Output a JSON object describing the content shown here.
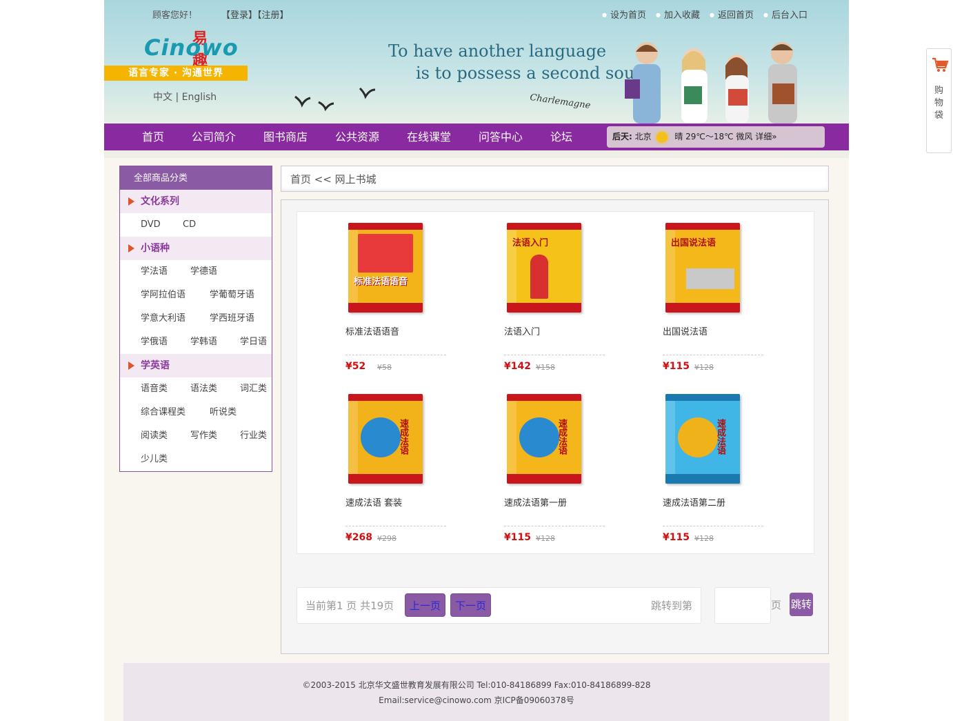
{
  "header": {
    "greeting": "顾客您好！",
    "login": "【登录】",
    "register": "【注册】",
    "top_links": [
      "设为首页",
      "加入收藏",
      "返回首页",
      "后台入口"
    ],
    "logo_cn": "易趣",
    "logo_en": "Cinowo",
    "slogan": "语言专家 · 沟通世界",
    "lang_switch": "中文 | English",
    "quote_line1": "To have another language",
    "quote_line2": "is to possess a second soul.",
    "signature": "Charlemagne"
  },
  "nav": {
    "items": [
      "首页",
      "公司简介",
      "图书商店",
      "公共资源",
      "在线课堂",
      "问答中心",
      "论坛"
    ],
    "weather_day": "后天:",
    "weather_city": "北京",
    "weather_text": "晴  29℃～18℃  微风  详细»"
  },
  "sidebar": {
    "title": "全部商品分类",
    "cat1": "文化系列",
    "cat1_items": [
      "DVD",
      "CD"
    ],
    "cat2": "小语种",
    "cat2_items": [
      "学法语",
      "学德语",
      "学阿拉伯语",
      "学葡萄牙语",
      "学意大利语",
      "学西班牙语",
      "学俄语",
      "学韩语",
      "学日语"
    ],
    "cat3": "学英语",
    "cat3_items": [
      "语音类",
      "语法类",
      "词汇类",
      "综合课程类",
      "听说类",
      "阅读类",
      "写作类",
      "行业类",
      "少儿类"
    ]
  },
  "breadcrumb": "首页 << 网上书城",
  "products": [
    {
      "name": "标准法语语音",
      "price": "¥52",
      "old": "¥58",
      "cover_title": "标准法语语音",
      "color": "#f3b41a"
    },
    {
      "name": "法语入门",
      "price": "¥142",
      "old": "¥158",
      "cover_title": "法语入门",
      "color": "#f5c21a"
    },
    {
      "name": "出国说法语",
      "price": "¥115",
      "old": "¥128",
      "cover_title": "出国说法语",
      "color": "#f5b81a"
    },
    {
      "name": "速成法语 套装",
      "price": "¥268",
      "old": "¥298",
      "cover_title": "速成法语",
      "color": "#f2b21a"
    },
    {
      "name": "速成法语第一册",
      "price": "¥115",
      "old": "¥128",
      "cover_title": "速成法语",
      "color": "#f4b61a"
    },
    {
      "name": "速成法语第二册",
      "price": "¥115",
      "old": "¥128",
      "cover_title": "速成法语",
      "color": "#3fb6e6"
    }
  ],
  "pager": {
    "info": "当前第1 页  共19页",
    "prev": "上一页",
    "next": "下一页",
    "jump_label": "跳转到第",
    "unit": "页",
    "go": "跳转"
  },
  "footer": {
    "line1": "©2003-2015     北京华文盛世教育发展有限公司     Tel:010-84186899 Fax:010-84186899-828",
    "line2": "Email:service@cinowo.com      京ICP备09060378号"
  },
  "cart": {
    "label": "购物袋"
  }
}
